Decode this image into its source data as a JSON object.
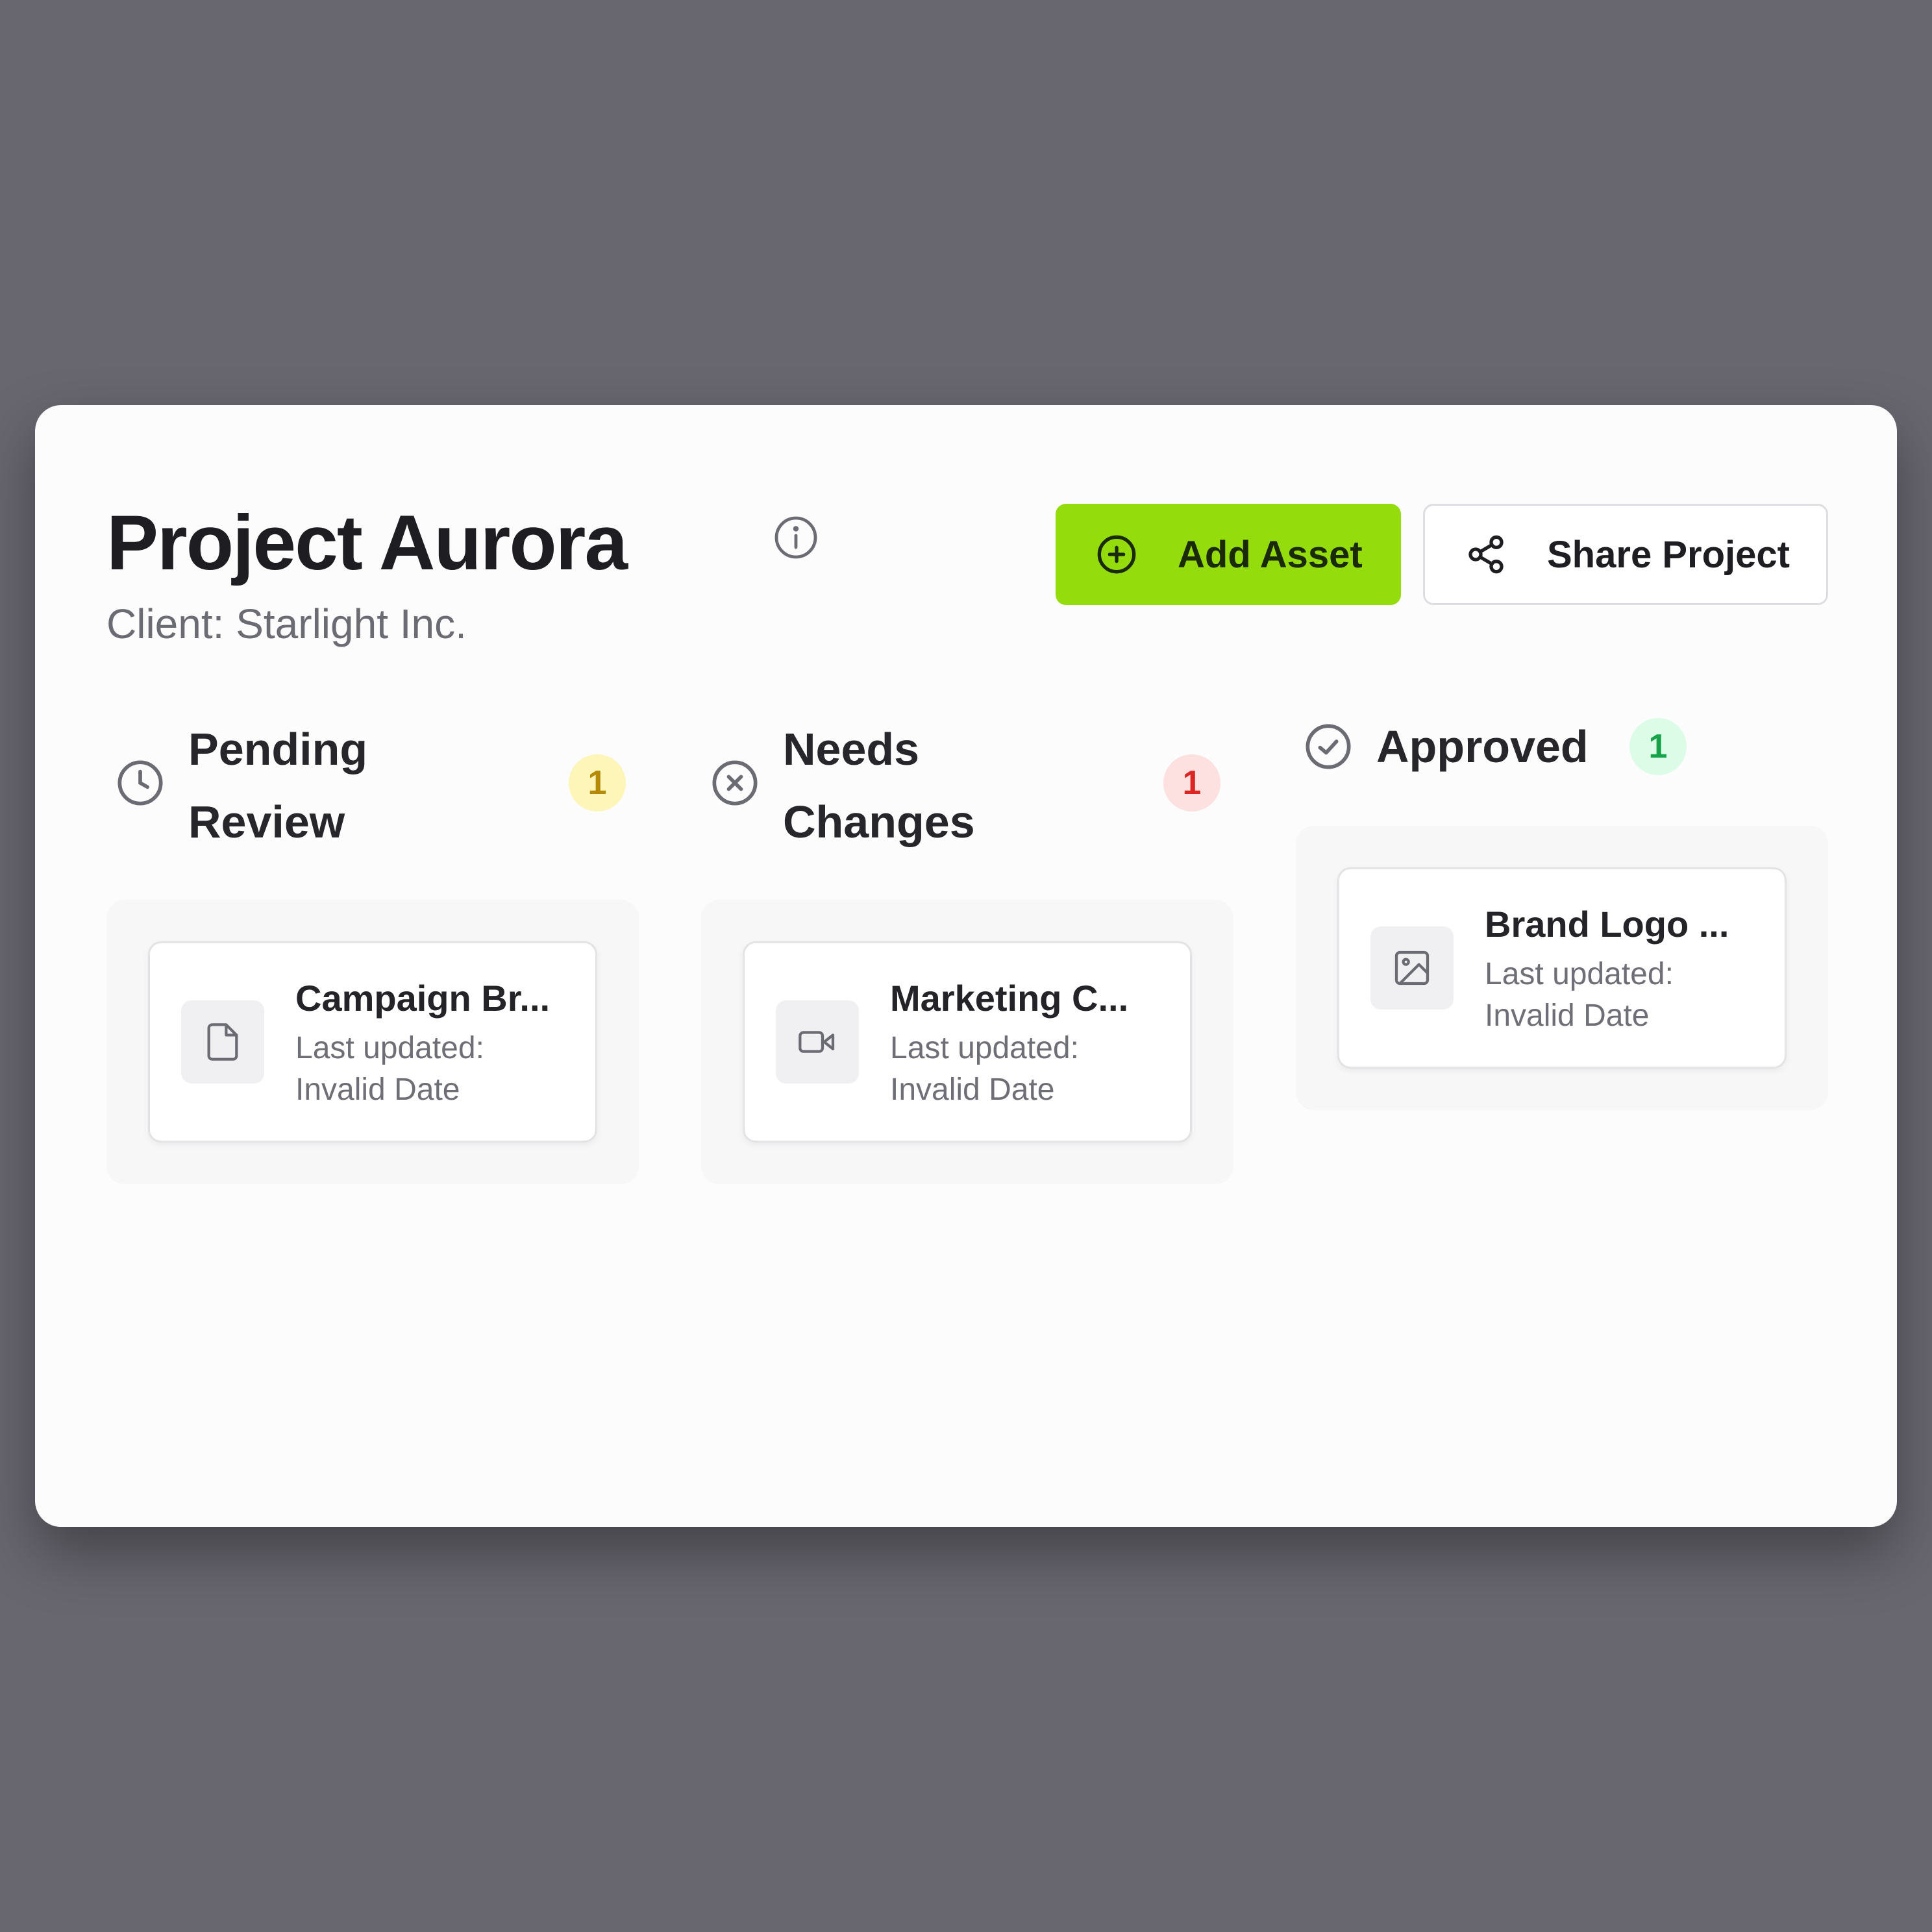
{
  "project": {
    "title": "Project Aurora",
    "client": "Client: Starlight Inc."
  },
  "actions": {
    "add_asset": "Add Asset",
    "share_project": "Share Project"
  },
  "columns": [
    {
      "title_line1": "Pending",
      "title_line2": "Review",
      "count": "1",
      "icon": "clock-icon",
      "badge_bg": "#fdf6b8",
      "badge_fg": "#b48a06",
      "assets": [
        {
          "name": "Campaign Br...",
          "meta_label": "Last updated:",
          "meta_value": "Invalid Date",
          "icon": "file-icon"
        }
      ]
    },
    {
      "title_line1": "Needs",
      "title_line2": "Changes",
      "count": "1",
      "icon": "x-circle-icon",
      "badge_bg": "#fde0e0",
      "badge_fg": "#dc2626",
      "assets": [
        {
          "name": "Marketing C...",
          "meta_label": "Last updated:",
          "meta_value": "Invalid Date",
          "icon": "video-icon"
        }
      ]
    },
    {
      "title_line1": "Approved",
      "title_line2": "",
      "count": "1",
      "icon": "check-circle-icon",
      "badge_bg": "#dcfce7",
      "badge_fg": "#16a34a",
      "assets": [
        {
          "name": "Brand Logo ...",
          "meta_label": "Last updated:",
          "meta_value": "Invalid Date",
          "icon": "image-icon"
        }
      ]
    }
  ],
  "colors": {
    "accent": "#95dc0d",
    "background": "#68666f",
    "card": "#fcfcfc"
  }
}
